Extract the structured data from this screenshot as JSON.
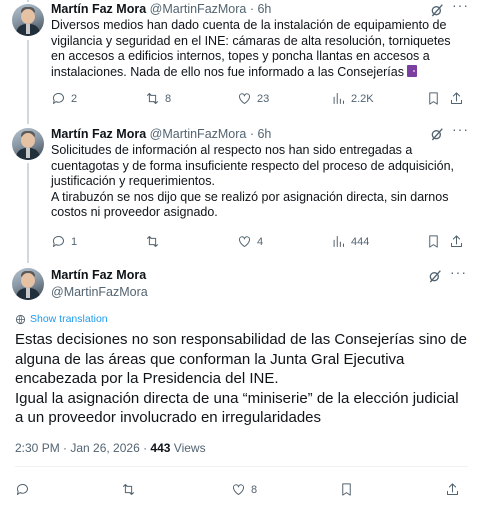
{
  "tweets": [
    {
      "name": "Martín Faz Mora",
      "handle": "@MartinFazMora · 6h",
      "text": "Diversos medios han dado cuenta de la instalación de equipamiento de vigilancia y seguridad en el INE: cámaras de alta resolución, torniquetes en accesos a edificios internos, topes y poncha llantas en accesos a instalaciones. Nada de ello nos fue informado a las Consejerías",
      "emoji_icon": "door-icon",
      "replies": "2",
      "reposts": "8",
      "likes": "23",
      "views": "2.2K"
    },
    {
      "name": "Martín Faz Mora",
      "handle": "@MartinFazMora · 6h",
      "text_lines": [
        "Solicitudes de información al respecto nos han sido entregadas a cuentagotas y de forma insuficiente respecto del proceso de adquisición, justificación y requerimientos.",
        "A tirabuzón se nos dijo que se realizó por asignación directa, sin darnos costos ni proveedor asignado."
      ],
      "replies": "1",
      "reposts": "",
      "likes": "4",
      "views": "444"
    }
  ],
  "main": {
    "name": "Martín Faz Mora",
    "handle": "@MartinFazMora",
    "show_translation": "Show translation",
    "text_lines": [
      "Estas decisiones no son responsabilidad de las Consejerías sino de alguna de las áreas que conforman la Junta Gral Ejecutiva encabezada por la Presidencia del INE.",
      "Igual la asignación directa de una “miniserie” de la elección judicial a un proveedor involucrado en irregularidades"
    ],
    "time": "2:30 PM · Jan 26, 2026 · ",
    "views_count": "443",
    "views_label": " Views",
    "likes": "8"
  }
}
